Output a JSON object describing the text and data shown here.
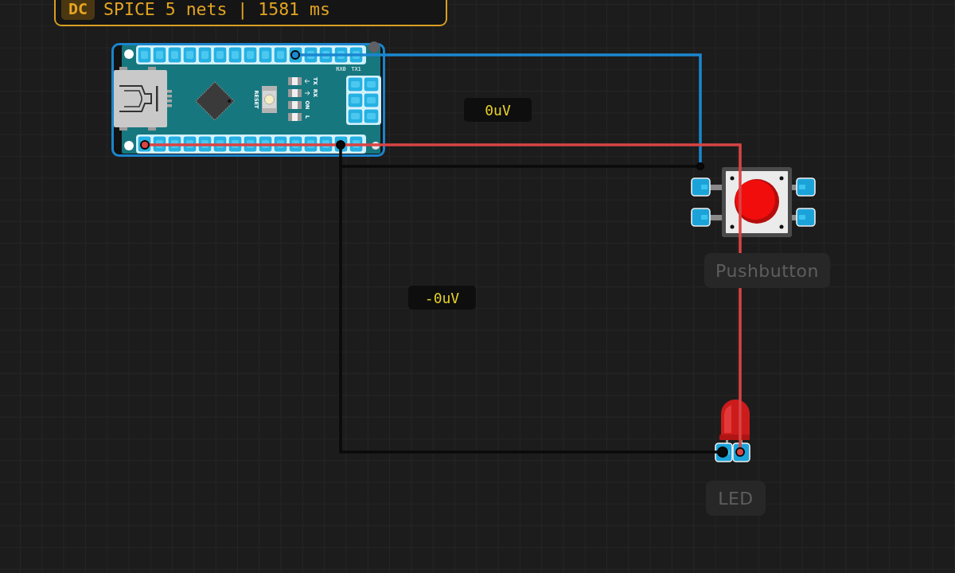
{
  "status": {
    "mode": "DC",
    "summary": "SPICE 5 nets | 1581 ms"
  },
  "components": [
    {
      "kind": "arduino-nano",
      "selected": true,
      "board_labels": {
        "reset": "RESET",
        "leds": [
          "TX",
          "RX",
          "ON",
          "L"
        ],
        "pins": [
          "RX0",
          "TX1"
        ]
      }
    },
    {
      "kind": "pushbutton",
      "selected": false,
      "label": "Pushbutton"
    },
    {
      "kind": "led",
      "selected": false,
      "label": "LED"
    }
  ],
  "probes": [
    {
      "reading": "0uV"
    },
    {
      "reading": "-0uV"
    }
  ],
  "wires": [
    {
      "color": "#1b87cf"
    },
    {
      "color": "#d94444"
    },
    {
      "color": "#0a0a0a"
    },
    {
      "color": "#0a0a0a"
    }
  ]
}
